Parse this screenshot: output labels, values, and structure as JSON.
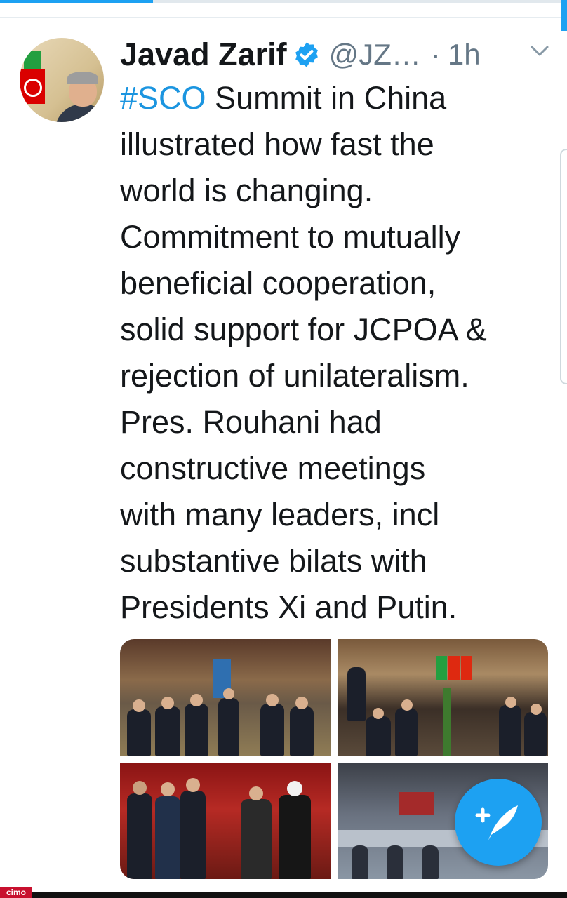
{
  "tweet": {
    "author_name": "Javad Zarif",
    "handle": "@JZ…",
    "separator": "·",
    "time": "1h",
    "hashtag": "#SCO",
    "text_lines": [
      " Summit in China",
      "illustrated how fast the",
      "world is changing.",
      "Commitment to mutually",
      "beneficial cooperation,",
      "solid support for JCPOA &",
      "rejection of unilateralism.",
      "Pres. Rouhani had",
      "constructive meetings",
      "with many leaders, incl",
      "substantive bilats with",
      "Presidents Xi and Putin."
    ]
  },
  "progress": {
    "fraction": 0.27
  },
  "watermark": "cimo",
  "icons": {
    "verified": "verified-badge-icon",
    "chevron": "chevron-down-icon",
    "compose": "compose-tweet-icon"
  },
  "colors": {
    "accent": "#1da1f2",
    "link": "#1b95e0",
    "text": "#14171a",
    "secondary": "#657786"
  }
}
